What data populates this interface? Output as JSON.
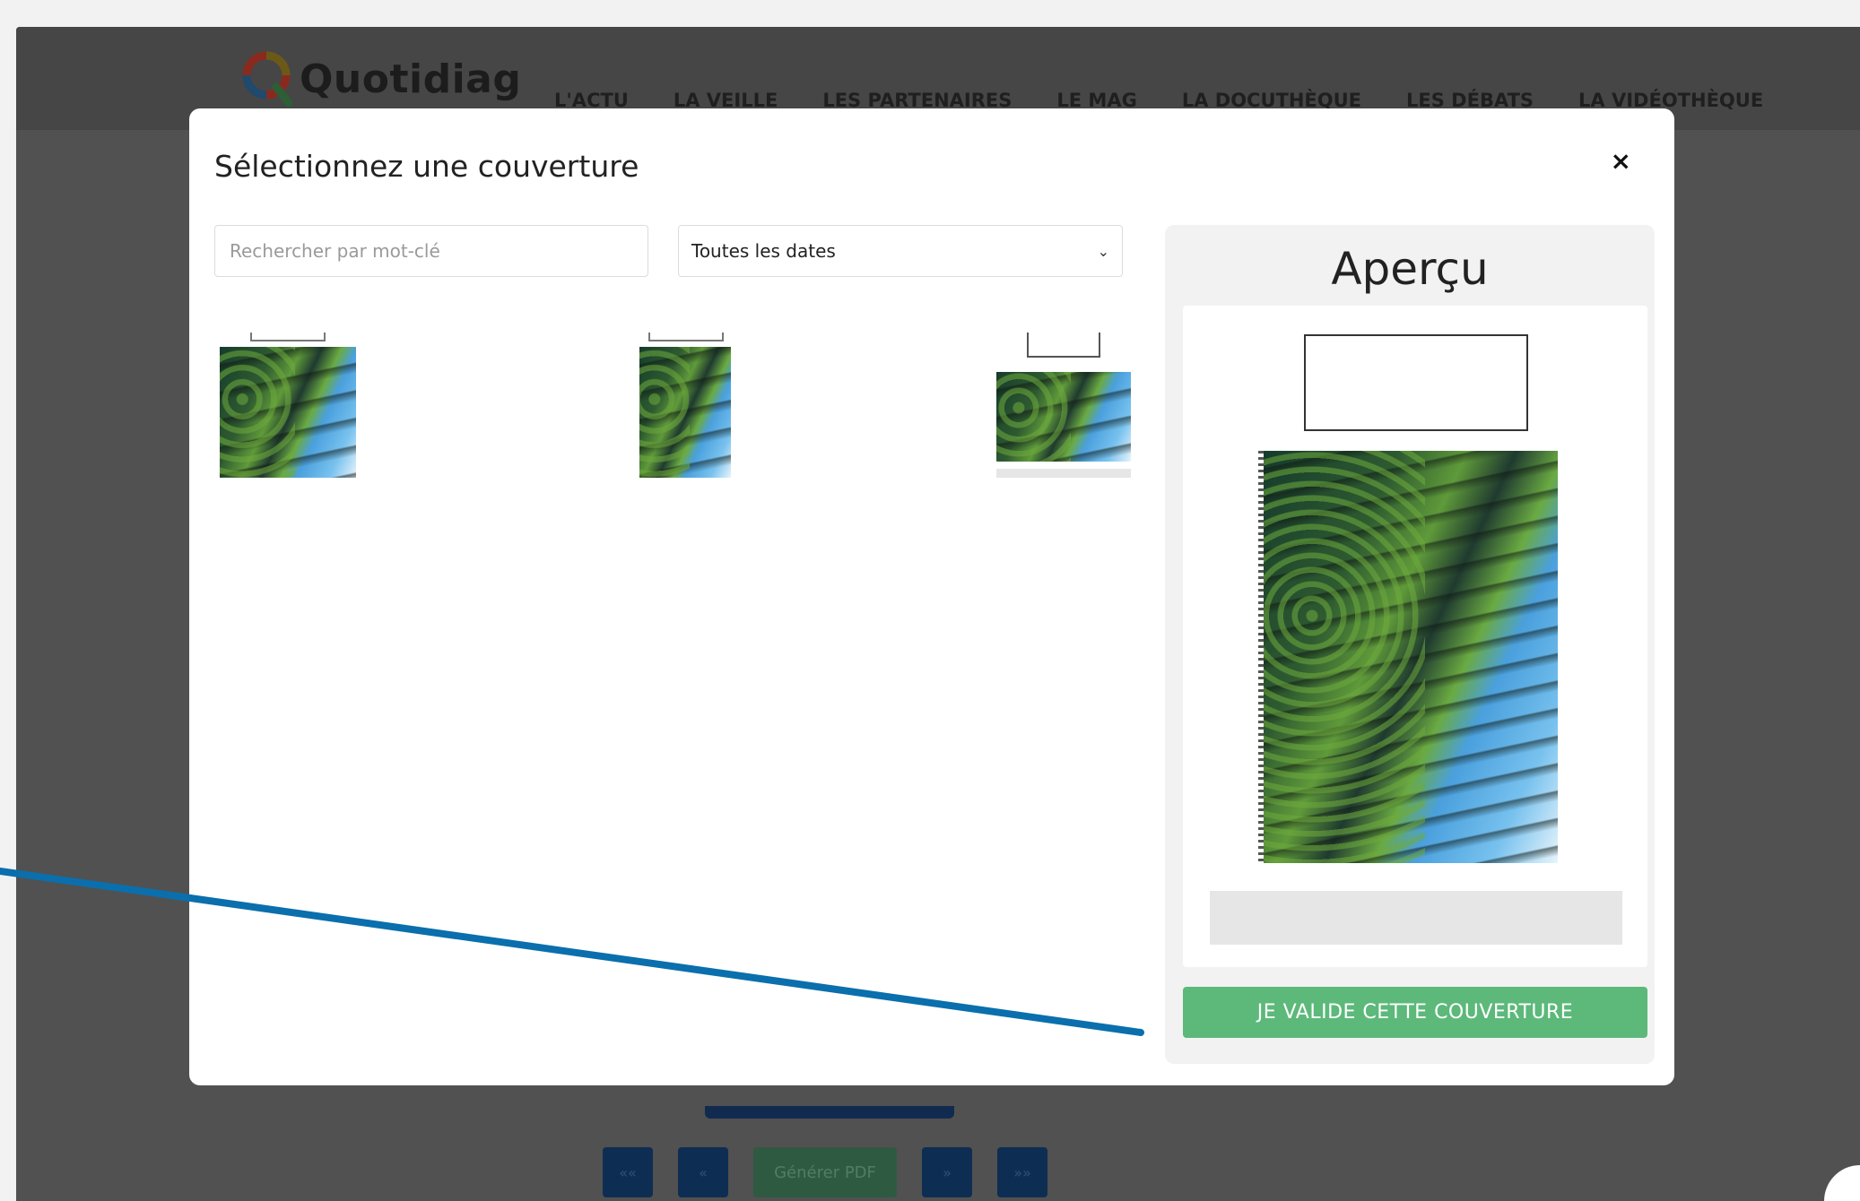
{
  "brand": {
    "name": "Quotidiag"
  },
  "nav": {
    "items": [
      "L'ACTU",
      "LA VEILLE",
      "LES PARTENAIRES",
      "LE MAG",
      "LA DOCUTHÈQUE",
      "LES DÉBATS",
      "LA VIDÉOTHÈQUE"
    ]
  },
  "modal": {
    "title": "Sélectionnez une couverture",
    "close": "×",
    "search_placeholder": "Rechercher par mot-clé",
    "date_filter": "Toutes les dates",
    "preview_title": "Aperçu",
    "validate_label": "JE VALIDE CETTE COUVERTURE"
  },
  "pager": {
    "first": "««",
    "prev": "«",
    "generate": "Générer PDF",
    "next": "»",
    "last": "»»"
  },
  "colors": {
    "overlay": "#515151",
    "validate": "#5cb97a",
    "annotation": "#0a6fac",
    "pager": "#0e2d52"
  }
}
